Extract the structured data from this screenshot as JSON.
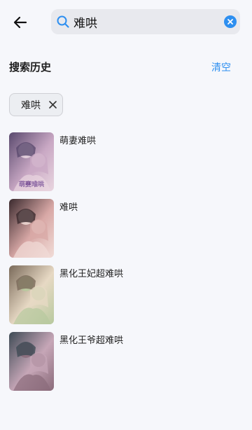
{
  "header": {
    "search": {
      "value": "难哄",
      "placeholder": ""
    }
  },
  "history": {
    "title": "搜索历史",
    "clear_label": "清空",
    "chips": [
      {
        "label": "难哄"
      }
    ]
  },
  "results": [
    {
      "title": "萌妻难哄",
      "cover_colors": [
        "#5a4a6e",
        "#c9a8c4",
        "#e9d6e0"
      ],
      "cover_caption": "萌妻难哄"
    },
    {
      "title": "难哄",
      "cover_colors": [
        "#3b2a2e",
        "#d8a8a6",
        "#f1dcd7"
      ],
      "cover_caption": ""
    },
    {
      "title": "黑化王妃超难哄",
      "cover_colors": [
        "#7a6a5a",
        "#e7d9c4",
        "#b7c99e"
      ],
      "cover_caption": ""
    },
    {
      "title": "黑化王爷超难哄",
      "cover_colors": [
        "#3e4b55",
        "#c6a6b7",
        "#8a6b7a"
      ],
      "cover_caption": ""
    }
  ],
  "colors": {
    "accent": "#2e8ff0",
    "background": "#f6f7fb"
  }
}
